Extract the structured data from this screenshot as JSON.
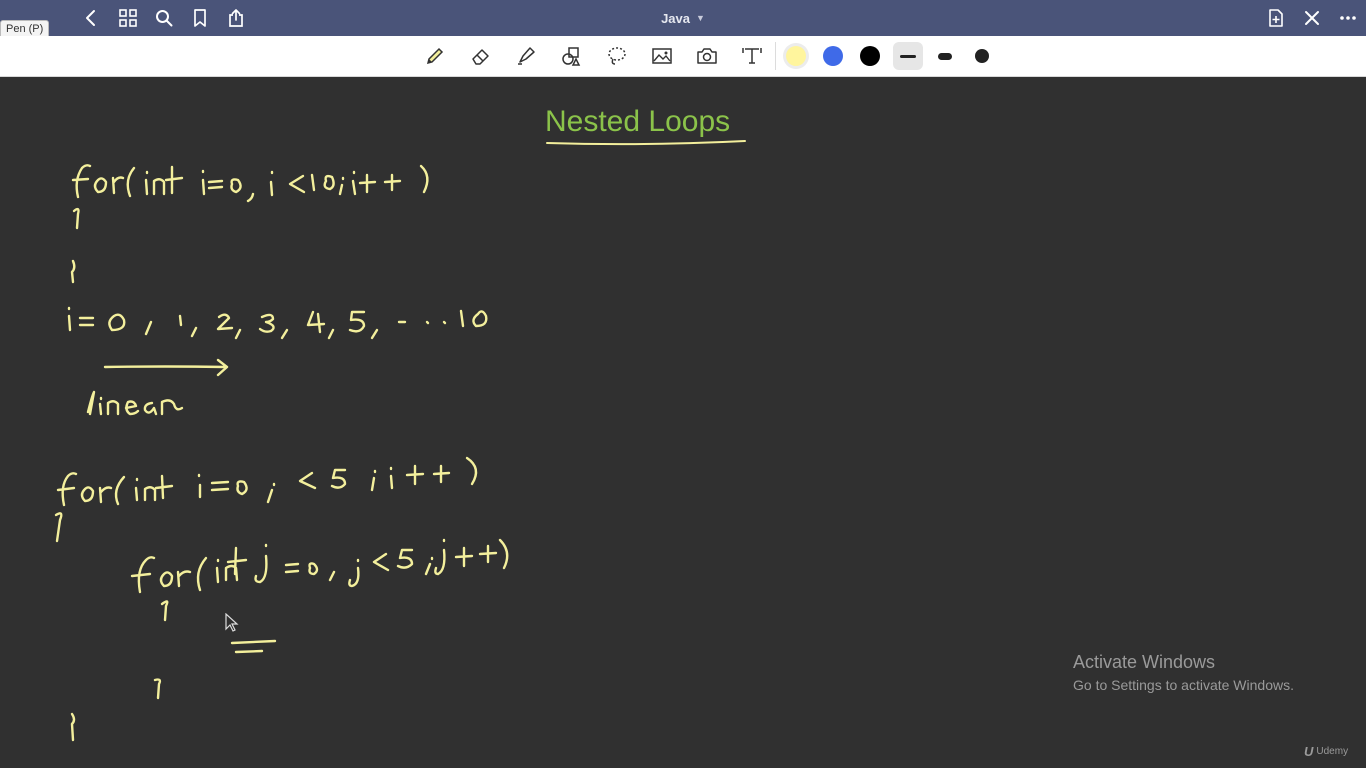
{
  "window": {
    "title": "Java",
    "tooltip": "Pen (P)"
  },
  "titlebar": {
    "left_icons": [
      "back-icon",
      "grid-icon",
      "search-icon",
      "bookmark-icon",
      "share-icon"
    ],
    "right_icons": [
      "add-page-icon",
      "close-icon",
      "more-icon"
    ]
  },
  "toolbar": {
    "tools": [
      "pen-icon",
      "eraser-icon",
      "highlighter-icon",
      "shapes-icon",
      "lasso-icon",
      "image-icon",
      "camera-icon",
      "text-icon"
    ],
    "colors": [
      "#fff59d",
      "#3f6ae8",
      "#000000"
    ],
    "sizes": [
      "thin",
      "medium",
      "thick"
    ],
    "selected_size": "thin"
  },
  "canvas": {
    "title": "Nested Loops",
    "title_color": "#8bc34a",
    "ink_color": "#f3ef9c",
    "handwriting": [
      "for(int i=0,i<10;i++)",
      "{",
      "}",
      "i=0, 1, 2, 3, 4, 5, - . . 10",
      "linear",
      "for(int i=0; i<5 ; i++)",
      "{",
      "for(int j=0; j<5;j++)",
      "{",
      "}",
      "}"
    ]
  },
  "watermark": {
    "line1": "Activate Windows",
    "line2": "Go to Settings to activate Windows."
  },
  "brand": {
    "name": "Udemy"
  }
}
